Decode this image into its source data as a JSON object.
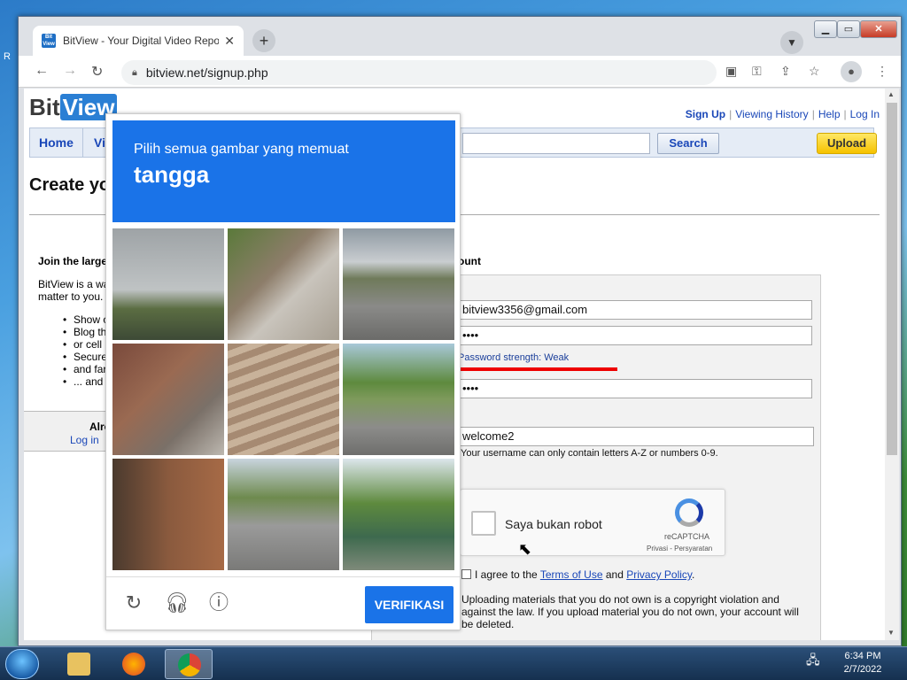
{
  "desktop": {
    "fragment": "R"
  },
  "browser": {
    "tab_title": "BitView - Your Digital Video Repo",
    "favicon_text": "Bit View",
    "new_tab": "+",
    "url": "bitview.net/signup.php"
  },
  "site": {
    "logo_bit": "Bit",
    "logo_view": "View",
    "links": {
      "signup": "Sign Up",
      "history": "Viewing History",
      "help": "Help",
      "login": "Log In"
    },
    "nav": {
      "home": "Home",
      "videos": "Vi"
    },
    "search_label": "Search",
    "upload_label": "Upload",
    "page_heading": "Create yo",
    "join": "Join the large",
    "desc1": "BitView is a wa",
    "desc2": "matter to you.",
    "bullets": [
      {
        "l1": "Show c",
        "l2": ""
      },
      {
        "l1": "Blog th",
        "l2": "or cell"
      },
      {
        "l1": "Secure",
        "l2": "and far"
      },
      {
        "l1": "... and",
        "l2": ""
      }
    ],
    "already": "Alre",
    "login_link": "Log in"
  },
  "form": {
    "title": "ount",
    "email": "bitview3356@gmail.com",
    "password_mask": "••••",
    "password_strength": "Password strength: Weak",
    "confirm_mask": "••••",
    "username": "welcome2",
    "username_hint": "Your username can only contain letters A-Z or numbers 0-9.",
    "recaptcha_label": "Saya bukan robot",
    "recaptcha_brand": "reCAPTCHA",
    "recaptcha_links": "Privasi - Persyaratan",
    "agree_prefix": "I agree to the",
    "terms": "Terms of Use",
    "and": "and",
    "privacy": "Privacy Policy",
    "period": ".",
    "warning": "Uploading materials that you do not own is a copyright violation and against the law. If you upload material you do not own, your account will be deleted."
  },
  "captcha": {
    "prompt": "Pilih semua gambar yang memuat",
    "target": "tangga",
    "verify_label": "VERIFIKASI"
  },
  "taskbar": {
    "time": "6:34 PM",
    "date": "2/7/2022"
  }
}
